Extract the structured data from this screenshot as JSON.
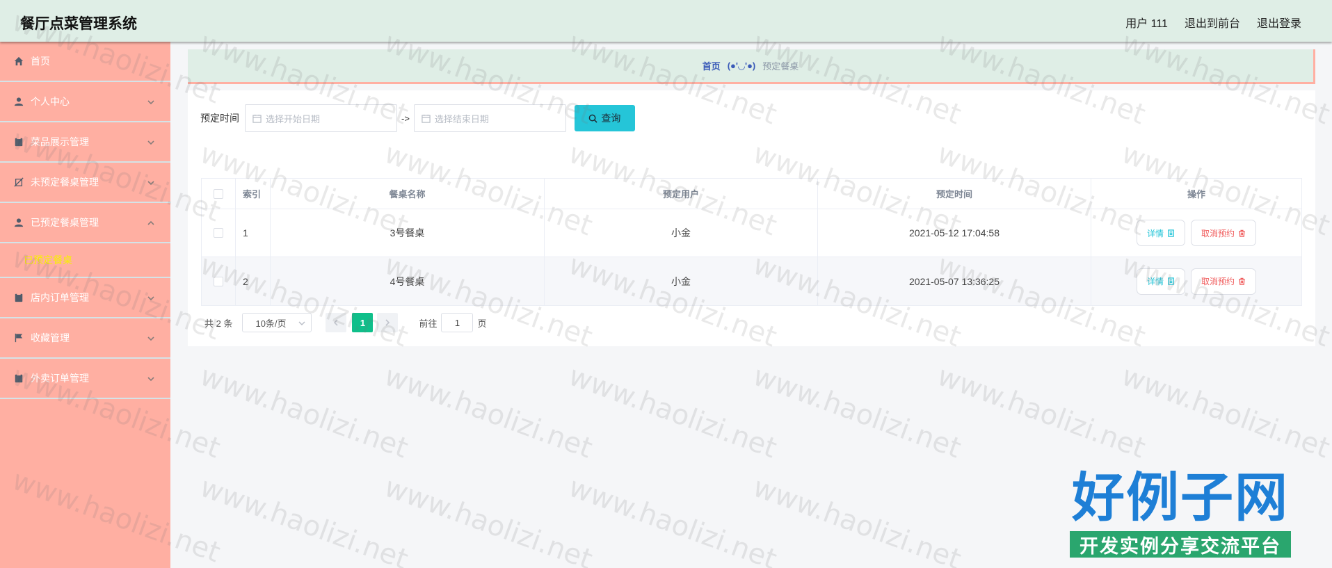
{
  "app": {
    "title": "餐厅点菜管理系统"
  },
  "topbar": {
    "user": "用户 111",
    "front": "退出到前台",
    "logout": "退出登录"
  },
  "sidebar": {
    "items": [
      {
        "label": "首页",
        "icon": "home-icon"
      },
      {
        "label": "个人中心",
        "icon": "user-icon"
      },
      {
        "label": "菜品展示管理",
        "icon": "clipboard-icon"
      },
      {
        "label": "未预定餐桌管理",
        "icon": "no-booking-icon"
      },
      {
        "label": "已预定餐桌管理",
        "icon": "user-icon"
      },
      {
        "label": "店内订单管理",
        "icon": "clipboard-icon"
      },
      {
        "label": "收藏管理",
        "icon": "flag-icon"
      },
      {
        "label": "外卖订单管理",
        "icon": "clipboard-icon"
      }
    ],
    "sub_active": "已预定餐桌"
  },
  "breadcrumb": {
    "home": "首页",
    "sep": "(●'◡'●)",
    "current": "预定餐桌"
  },
  "search": {
    "label": "预定时间",
    "start_placeholder": "选择开始日期",
    "sep": "->",
    "end_placeholder": "选择结束日期",
    "button": "查询"
  },
  "table": {
    "headers": [
      "索引",
      "餐桌名称",
      "预定用户",
      "预定时间",
      "操作"
    ],
    "rows": [
      {
        "index": "1",
        "name": "3号餐桌",
        "user": "小金",
        "time": "2021-05-12 17:04:58"
      },
      {
        "index": "2",
        "name": "4号餐桌",
        "user": "小金",
        "time": "2021-05-07 13:36:25"
      }
    ],
    "detail_label": "详情",
    "cancel_label": "取消预约"
  },
  "pager": {
    "total": "共 2 条",
    "page_size": "10条/页",
    "current": "1",
    "goto": "前往",
    "goto_value": "1",
    "page_unit": "页"
  },
  "watermark": "www.haolizi.net",
  "logo": {
    "main": "好例子网",
    "sub": "开发实例分享交流平台"
  },
  "colors": {
    "sidebar": "#ffafa2",
    "topbar": "#dfeee6",
    "accent": "#25c5d8",
    "pager_active": "#0fbf8a",
    "danger": "#f05a5a",
    "submenu_active": "#f7f000"
  }
}
